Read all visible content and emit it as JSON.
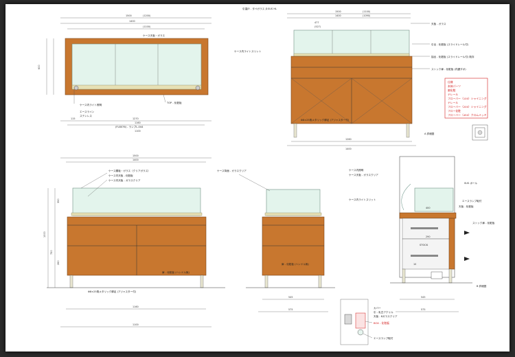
{
  "sheet": {
    "views": [
      {
        "id": "top-left",
        "widths": [
          "1500",
          "(1200)",
          "1400",
          "(1100)"
        ],
        "labels": [
          "ケース天板・ガラス",
          "ケース内ライト照明",
          "エースライン",
          "ステンレス",
          "TOP - 化粧板",
          "(FL8076) - ランプL-044"
        ],
        "sub_dims": [
          "115",
          "1270",
          "1160",
          "1100"
        ]
      },
      {
        "id": "top-right",
        "widths": [
          "1500",
          "(1100)",
          "1400",
          "(1090)"
        ],
        "labels": [
          "引違戸 - タペガラス 片SUS HL",
          "ケース内ライトスリット",
          "天板 - ガラス",
          "引出 - 化粧板 (スライドレール付)",
          "抽出 - 化粧板 (スライドレール付) 既存",
          "ストック扉 - 化粧板 (内鍵ダボ)",
          "Φ8×25角メタリック脚足 (アジャスター付)"
        ],
        "sub_dims": [
          "477",
          "(527)",
          "1260",
          "1400"
        ]
      }
    ],
    "legend_title": "仕様",
    "legend_items": [
      "本体パーツ",
      "扉化粧",
      "テレール",
      "フローバー（100）シャイニング",
      "テレール",
      "フローバー（200）シャイニング",
      "フロー化粧",
      "フローバー（450）クロムメッキ"
    ],
    "section_labels": [
      "A 詳細図",
      "B 詳細図"
    ],
    "front_view": {
      "widths": [
        "1500",
        "1400",
        "1160",
        "1100"
      ],
      "heights": [
        "1000",
        "750",
        "350",
        "260"
      ],
      "labels": [
        "ケース腰板・ガラス（クリアガラス）",
        "ケース内天板 - 化粧板",
        "ケース内天板 - ガラスクリア",
        "扉 - 化粧板 (ハンドル無)",
        "Φ8×25角メタリック脚足 (アジャスター付)"
      ]
    },
    "side_view": {
      "widths": [
        "545",
        "575"
      ],
      "labels": [
        "ケース背面 - ガラスクリア",
        "扉 - 化粧板 (ハンドル無)"
      ]
    },
    "section_view": {
      "widths": [
        "545",
        "575",
        "400",
        "290",
        "10"
      ],
      "labels": [
        "ケース内照明",
        "ケース内ライトスリット",
        "SUS ポール",
        "ストック扉 - 化粧板",
        "エースランプ取付",
        "ケース天板 - ガラスクリア",
        "天板 - 化粧板",
        "STOCK"
      ]
    },
    "detail_view": {
      "labels": [
        "カバー",
        "引 - 乳白アクリル",
        "天板 - 8ガラスクリア",
        "エースランプ取付",
        "BOX - 化粧板"
      ]
    }
  }
}
